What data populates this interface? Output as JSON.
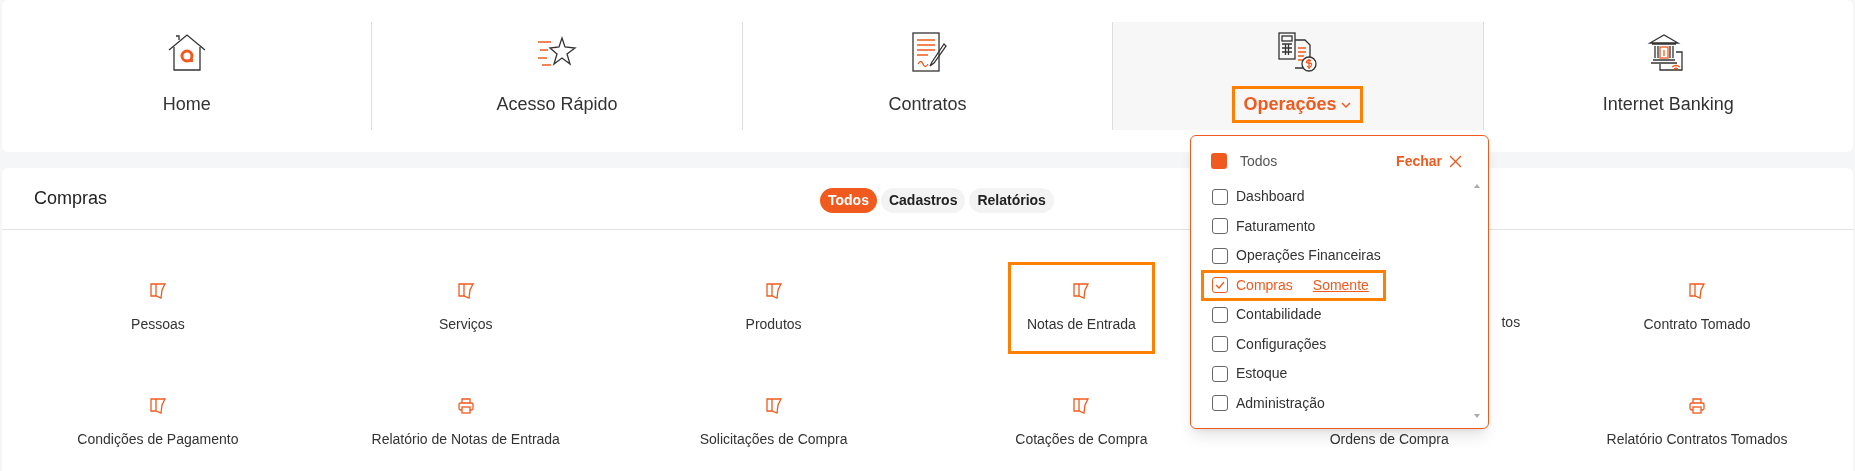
{
  "nav": [
    {
      "label": "Home",
      "selected": false
    },
    {
      "label": "Acesso Rápido",
      "selected": false
    },
    {
      "label": "Contratos",
      "selected": false
    },
    {
      "label": "Operações",
      "selected": true
    },
    {
      "label": "Internet Banking",
      "selected": false
    }
  ],
  "section": {
    "title": "Compras",
    "filters": [
      {
        "label": "Todos",
        "selected": true
      },
      {
        "label": "Cadastros",
        "selected": false
      },
      {
        "label": "Relatórios",
        "selected": false
      }
    ],
    "items": [
      {
        "label": "Pessoas",
        "kind": "document",
        "highlighted": false
      },
      {
        "label": "Serviços",
        "kind": "document",
        "highlighted": false
      },
      {
        "label": "Produtos",
        "kind": "document",
        "highlighted": false
      },
      {
        "label": "Notas de Entrada",
        "kind": "document",
        "highlighted": true
      },
      {
        "label": "tos",
        "kind": "covered"
      },
      {
        "label": "Contrato Tomado",
        "kind": "document",
        "highlighted": false
      },
      {
        "label": "Condições de Pagamento",
        "kind": "document",
        "highlighted": false
      },
      {
        "label": "Relatório de Notas de Entrada",
        "kind": "report",
        "highlighted": false
      },
      {
        "label": "Solicitações de Compra",
        "kind": "document",
        "highlighted": false
      },
      {
        "label": "Cotações de Compra",
        "kind": "document",
        "highlighted": false
      },
      {
        "label": "Ordens de Compra",
        "kind": "label_only",
        "highlighted": false
      },
      {
        "label": "Relatório Contratos Tomados",
        "kind": "report",
        "highlighted": false
      }
    ]
  },
  "dropdown": {
    "select_all": {
      "label": "Todos",
      "indeterminate": true
    },
    "close_button": "Fechar",
    "options": [
      {
        "label": "Dashboard",
        "checked": false,
        "highlighted": false
      },
      {
        "label": "Faturamento",
        "checked": false,
        "highlighted": false
      },
      {
        "label": "Operações Financeiras",
        "checked": false,
        "highlighted": false
      },
      {
        "label": "Compras",
        "checked": true,
        "highlighted": true,
        "link": "Somente"
      },
      {
        "label": "Contabilidade",
        "checked": false,
        "highlighted": false
      },
      {
        "label": "Configurações",
        "checked": false,
        "highlighted": false
      },
      {
        "label": "Estoque",
        "checked": false,
        "highlighted": false
      },
      {
        "label": "Administração",
        "checked": false,
        "highlighted": false
      }
    ]
  }
}
